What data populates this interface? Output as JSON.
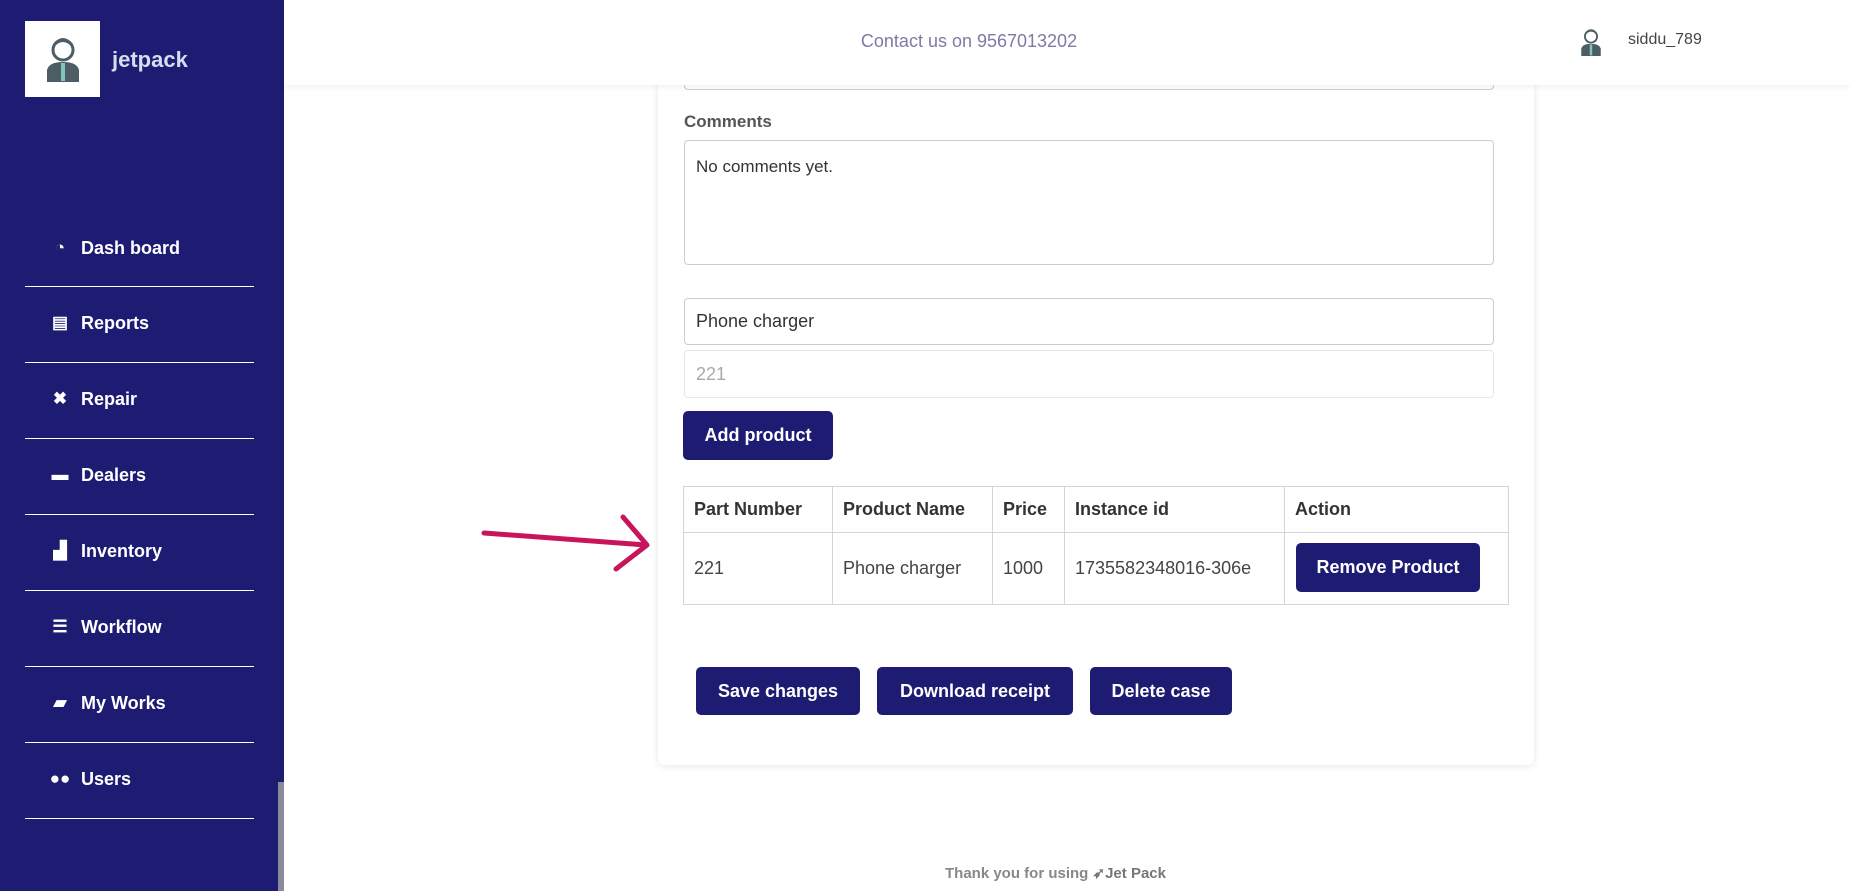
{
  "sidebar": {
    "brand": "jetpack",
    "items": [
      {
        "label": "Dash board",
        "icon": "gauge-icon"
      },
      {
        "label": "Reports",
        "icon": "file-icon"
      },
      {
        "label": "Repair",
        "icon": "tools-icon"
      },
      {
        "label": "Dealers",
        "icon": "store-icon"
      },
      {
        "label": "Inventory",
        "icon": "boxes-icon"
      },
      {
        "label": "Workflow",
        "icon": "list-check-icon"
      },
      {
        "label": "My Works",
        "icon": "folder-open-icon"
      },
      {
        "label": "Users",
        "icon": "users-icon"
      }
    ]
  },
  "header": {
    "contact": "Contact us on 9567013202",
    "username": "siddu_789"
  },
  "form": {
    "comments_label": "Comments",
    "comments_value": "No comments yet.",
    "product_name_value": "Phone charger",
    "part_number_placeholder": "221",
    "add_product_label": "Add product"
  },
  "table": {
    "headers": [
      "Part Number",
      "Product Name",
      "Price",
      "Instance id",
      "Action"
    ],
    "rows": [
      {
        "part_number": "221",
        "product_name": "Phone charger",
        "price": "1000",
        "instance_id": "1735582348016-306e",
        "action": "Remove Product"
      }
    ]
  },
  "actions": {
    "save": "Save changes",
    "download": "Download receipt",
    "delete": "Delete case"
  },
  "footer": {
    "text": "Thank you for using",
    "brand": "Jet Pack"
  },
  "colors": {
    "primary": "#1e1b73",
    "annotation_arrow": "#c8145a"
  }
}
